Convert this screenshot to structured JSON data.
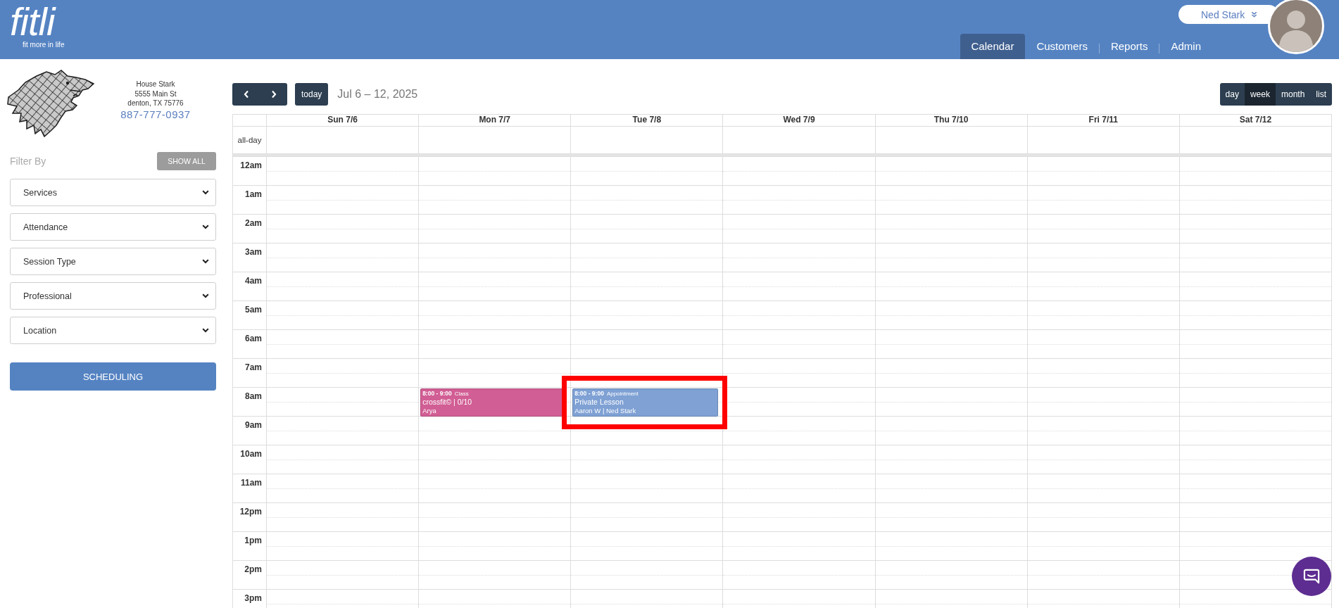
{
  "brand": {
    "wordmark": "fitli",
    "tagline": "fit more in life"
  },
  "user": {
    "name": "Ned Stark"
  },
  "nav": [
    {
      "label": "Calendar",
      "selected": true
    },
    {
      "label": "Customers",
      "selected": false
    },
    {
      "label": "Reports",
      "selected": false
    },
    {
      "label": "Admin",
      "selected": false
    }
  ],
  "business": {
    "name": "House Stark",
    "street": "5555 Main St",
    "city": "denton, TX 75776",
    "phone": "887-777-0937"
  },
  "filters": {
    "title": "Filter By",
    "show_all": "SHOW ALL",
    "dropdowns": [
      {
        "label": "Services"
      },
      {
        "label": "Attendance"
      },
      {
        "label": "Session Type"
      },
      {
        "label": "Professional"
      },
      {
        "label": "Location"
      }
    ]
  },
  "scheduling_button": "SCHEDULING",
  "calendar": {
    "today": "today",
    "title": "Jul 6 – 12, 2025",
    "views": [
      {
        "label": "day",
        "selected": false
      },
      {
        "label": "week",
        "selected": true
      },
      {
        "label": "month",
        "selected": false
      },
      {
        "label": "list",
        "selected": false
      }
    ],
    "all_day": "all-day",
    "hours": [
      "12am",
      "1am",
      "2am",
      "3am",
      "4am",
      "5am",
      "6am",
      "7am",
      "8am",
      "9am",
      "10am",
      "11am",
      "12pm",
      "1pm",
      "2pm",
      "3pm"
    ],
    "days": [
      {
        "label": "Sun 7/6"
      },
      {
        "label": "Mon 7/7",
        "events": [
          {
            "time": "8:00 - 9:00",
            "type": "Class",
            "title": "crossfit© | 0/10",
            "people": "Arya",
            "color": "#d15e94",
            "highlighted": false
          }
        ]
      },
      {
        "label": "Tue 7/8",
        "events": [
          {
            "time": "8:00 - 9:00",
            "type": "Appointment",
            "title": "Private Lesson",
            "people": "Aaron W | Ned Stark",
            "color": "#7fa1d4",
            "highlighted": true
          }
        ]
      },
      {
        "label": "Wed 7/9"
      },
      {
        "label": "Thu 7/10"
      },
      {
        "label": "Fri 7/11"
      },
      {
        "label": "Sat 7/12"
      }
    ]
  }
}
